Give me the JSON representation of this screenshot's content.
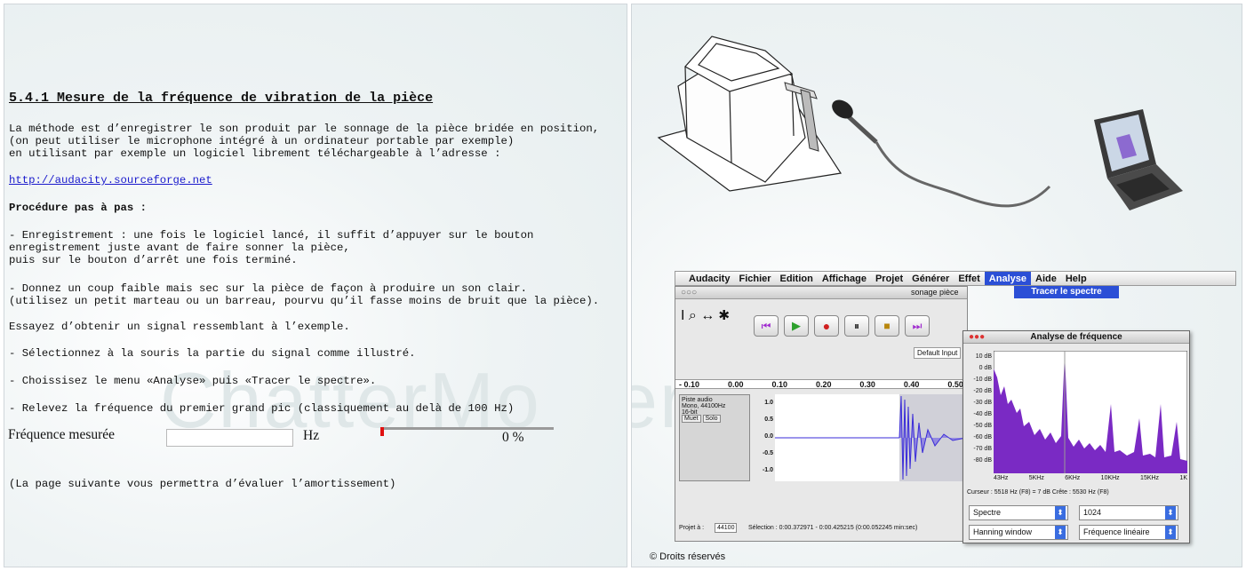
{
  "left": {
    "watermark": "ChatterMo",
    "heading": "5.4.1 Mesure de la fréquence de vibration de la pièce",
    "intro_1": "La méthode est d’enregistrer le son produit par le sonnage de la pièce bridée en position,",
    "intro_2": "(on peut utiliser le microphone intégré à un ordinateur portable par exemple)",
    "intro_3": "en utilisant par exemple un logiciel librement téléchargeable à l’adresse :",
    "link": "http://audacity.sourceforge.net",
    "procedure_title": "Procédure pas à pas :",
    "step1_a": "- Enregistrement : une fois le logiciel lancé, il suffit d’appuyer sur le bouton",
    "step1_b": "enregistrement juste avant de faire sonner la pièce,",
    "step1_c": "puis sur le bouton d’arrêt une fois terminé.",
    "step2_a": "- Donnez un coup faible mais sec sur la pièce de façon à produire un son clair.",
    "step2_b": "(utilisez un petit marteau ou un barreau, pourvu qu’il fasse moins de bruit que la pièce).",
    "step3": "Essayez d’obtenir un signal ressemblant à l’exemple.",
    "step4": "- Sélectionnez à la souris la partie du signal comme illustré.",
    "step5": "- Choissisez le menu «Analyse» puis «Tracer le spectre».",
    "step6": "- Relevez la fréquence du premier grand pic (classiquement au delà de 100 Hz)",
    "freq_label": "Fréquence mesurée",
    "freq_value": "",
    "freq_unit": "Hz",
    "progress": 0.0,
    "progress_text": "0 %",
    "next_note": "(La page suivante vous permettra d’évaluer l’amortissement)"
  },
  "right": {
    "watermark": "erMo",
    "menu": [
      "Audacity",
      "Fichier",
      "Edition",
      "Affichage",
      "Projet",
      "Générer",
      "Effet",
      "Analyse",
      "Aide",
      "Help"
    ],
    "menu_selected": "Analyse",
    "menu_item": "Tracer le spectre",
    "window_title": "sonage pièce",
    "default_input": "Default Input",
    "ruler": [
      "- 0.10",
      "0.00",
      "0.10",
      "0.20",
      "0.30",
      "0.40",
      "0.50"
    ],
    "track_name": "Piste audio",
    "track_info_1": "Mono, 44100Hz",
    "track_info_2": "16-bit",
    "mute": "Muet",
    "solo": "Solo",
    "amp_ticks": [
      "1.0",
      "0.5",
      "0.0",
      "-0.5",
      "-1.0"
    ],
    "project_rate_label": "Projet à :",
    "project_rate": "44100",
    "selection": "Sélection : 0:00.372971 - 0:00.425215 (0:00.052245 min:sec)",
    "spectrum_title": "Analyse de fréquence",
    "db_ticks": [
      "10 dB",
      "0 dB",
      "-10 dB",
      "-20 dB",
      "-30 dB",
      "-40 dB",
      "-50 dB",
      "-60 dB",
      "-70 dB",
      "-80 dB"
    ],
    "freq_ticks": [
      "43Hz",
      "5KHz",
      "6KHz",
      "10KHz",
      "15KHz",
      "1K"
    ],
    "cursor_text": "Curseur : 5518 Hz (F8) = 7 dB   Crête : 5530 Hz (F8)",
    "algo": "Spectre",
    "size": "1024",
    "window_fn": "Hanning window",
    "axis_mode": "Fréquence linéaire",
    "copyright": "© Droits réservés",
    "colors": {
      "spectrum": "#7a2ac4",
      "menu_highlight": "#2b4fd6",
      "waveform": "#3a2bd8"
    }
  }
}
